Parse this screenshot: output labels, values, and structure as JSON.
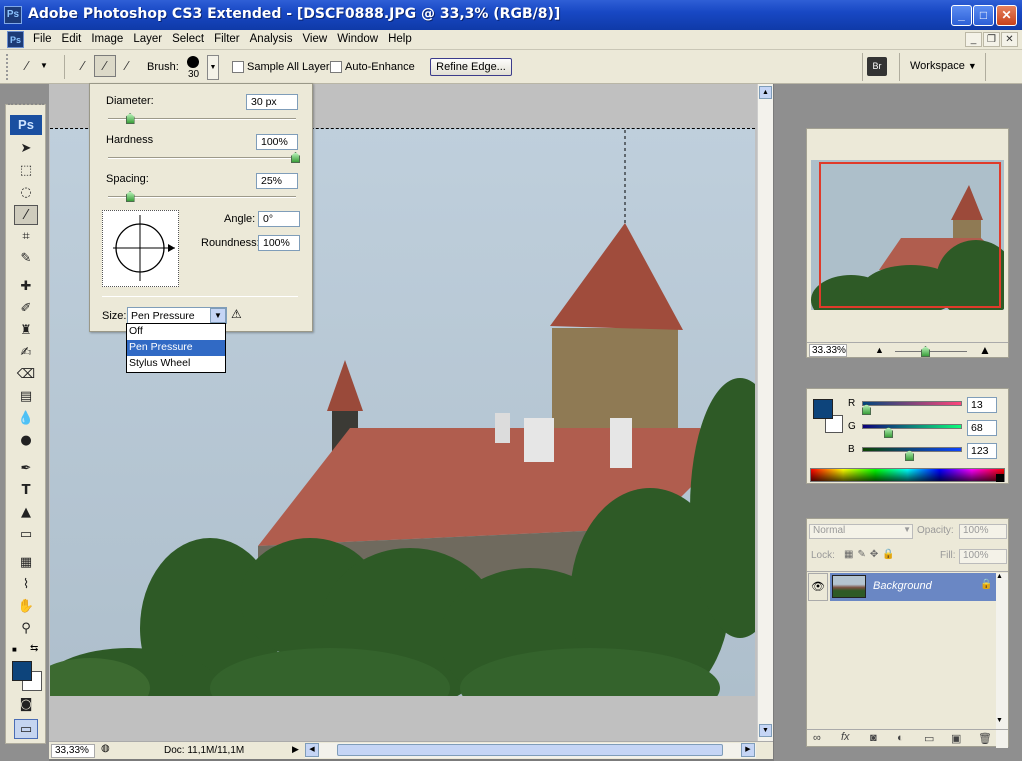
{
  "window": {
    "title": "Adobe Photoshop CS3 Extended - [DSCF0888.JPG @ 33,3% (RGB/8)]",
    "app_icon": "Ps",
    "controls": [
      "minimize",
      "maximize",
      "close"
    ]
  },
  "menubar": {
    "items": [
      "File",
      "Edit",
      "Image",
      "Layer",
      "Select",
      "Filter",
      "Analysis",
      "View",
      "Window",
      "Help"
    ]
  },
  "options_bar": {
    "brush_label": "Brush:",
    "brush_size": "30",
    "sample_all_layers": "Sample All Layers",
    "auto_enhance": "Auto-Enhance",
    "refine_edge": "Refine Edge...",
    "workspace": "Workspace"
  },
  "toolbar": {
    "logo": "Ps"
  },
  "brush_popup": {
    "diameter_label": "Diameter:",
    "diameter_value": "30 px",
    "diameter_pct": 0.12,
    "hardness_label": "Hardness",
    "hardness_value": "100%",
    "hardness_pct": 1.0,
    "spacing_label": "Spacing:",
    "spacing_value": "25%",
    "spacing_pct": 0.12,
    "angle_label": "Angle:",
    "angle_value": "0°",
    "roundness_label": "Roundness:",
    "roundness_value": "100%",
    "size_label": "Size:",
    "size_selected": "Pen Pressure",
    "size_options": [
      "Off",
      "Pen Pressure",
      "Stylus Wheel"
    ]
  },
  "status_bar": {
    "zoom": "33,33%",
    "doc": "Doc: 11,1M/11,1M"
  },
  "navigator": {
    "zoom": "33.33%"
  },
  "color_panel": {
    "r_label": "R",
    "g_label": "G",
    "b_label": "B",
    "r_value": "13",
    "g_value": "68",
    "b_value": "123",
    "foreground": "#0d447b"
  },
  "layers_panel": {
    "blend_mode": "Normal",
    "opacity_label": "Opacity:",
    "opacity_value": "100%",
    "lock_label": "Lock:",
    "fill_label": "Fill:",
    "fill_value": "100%",
    "layer_name": "Background"
  }
}
